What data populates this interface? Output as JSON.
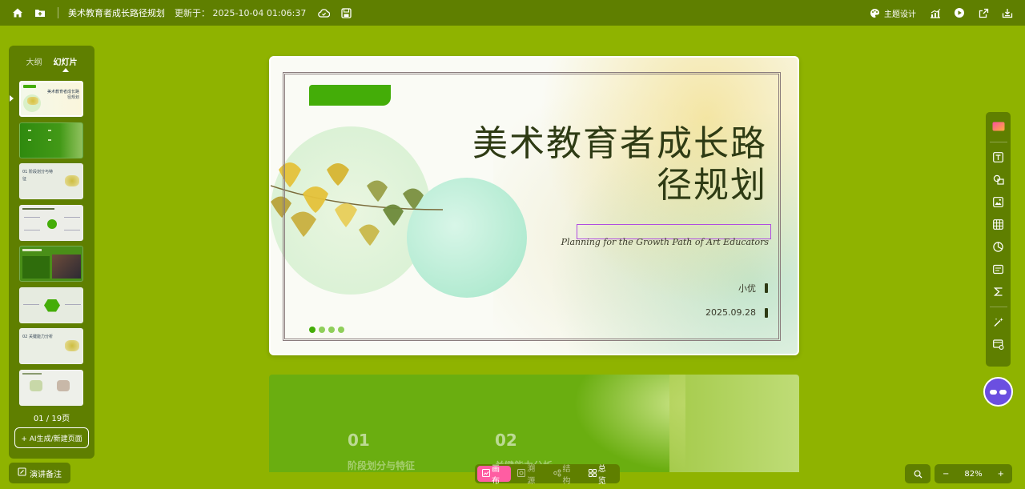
{
  "topbar": {
    "title": "美术教育者成长路径规划",
    "updated": "更新于： 2025-10-04 01:06:37",
    "theme_label": "主题设计"
  },
  "leftpanel": {
    "tabs": [
      {
        "label": "大纲",
        "active": false
      },
      {
        "label": "幻灯片",
        "active": true
      }
    ],
    "thumbnails": [
      {
        "text": "美术教育者成长路径规划",
        "bg": "#f5f9ee"
      },
      {
        "text": "",
        "bg": "#3f8f10"
      },
      {
        "text": "01 阶段划分与特征",
        "bg": "#e9ede4"
      },
      {
        "text": "",
        "bg": "#eceee8"
      },
      {
        "text": "",
        "bg": "#4a8f18"
      },
      {
        "text": "",
        "bg": "#e6ebe0"
      },
      {
        "text": "02 关键能力分析",
        "bg": "#eaeee4"
      },
      {
        "text": "",
        "bg": "#eef0ea"
      }
    ],
    "page_count": "01 / 19页",
    "new_page_label": "+ AI生成/新建页面"
  },
  "notes_label": "演讲备注",
  "slide": {
    "title": "美术教育者成长路径规划",
    "subtitle": "Planning for the Growth Path of Art Educators",
    "author": "小优",
    "date": "2025.09.28"
  },
  "slide2": {
    "items": [
      {
        "num": "01",
        "label": "阶段划分与特征"
      },
      {
        "num": "02",
        "label": "关键能力分析"
      }
    ]
  },
  "viewbar": {
    "canvas": "画布",
    "source": "溯源",
    "structure": "结构",
    "overview": "总览"
  },
  "zoom": {
    "minus": "−",
    "level": "82%",
    "plus": "+"
  },
  "colors": {
    "accent": "#44ad08",
    "bar": "#5f7f00",
    "bg": "#8fb300",
    "active_view": "#ff5da2"
  }
}
